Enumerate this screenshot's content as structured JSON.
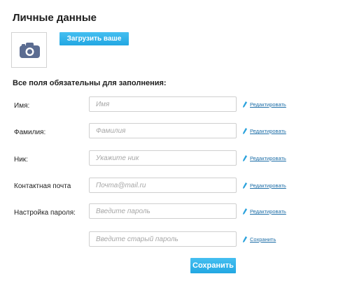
{
  "page": {
    "title": "Личные данные",
    "upload_button": "Загрузить ваше фото",
    "required_notice": "Все поля обязательны для заполнения:",
    "save_button": "Сохранить"
  },
  "icons": {
    "photo_placeholder": "camera-icon",
    "edit": "pencil-icon"
  },
  "colors": {
    "accent": "#2fb3ea",
    "link": "#1f6fa8",
    "camera_icon": "#5b6c91"
  },
  "fields": [
    {
      "label": "Имя:",
      "placeholder": "Имя",
      "value": "",
      "action": "Редактировать"
    },
    {
      "label": "Фамилия:",
      "placeholder": "Фамилия",
      "value": "",
      "action": "Редактировать"
    },
    {
      "label": "Ник:",
      "placeholder": "Укажите ник",
      "value": "",
      "action": "Редактировать"
    },
    {
      "label": "Контактная почта",
      "placeholder": "Почта@mail.ru",
      "value": "",
      "action": "Редактировать"
    },
    {
      "label": "Настройка пароля:",
      "placeholder": "Введите пароль",
      "value": "",
      "action": "Редактировать"
    },
    {
      "label": "",
      "placeholder": "Введите старый пароль",
      "value": "",
      "action": "Сохранить"
    }
  ]
}
